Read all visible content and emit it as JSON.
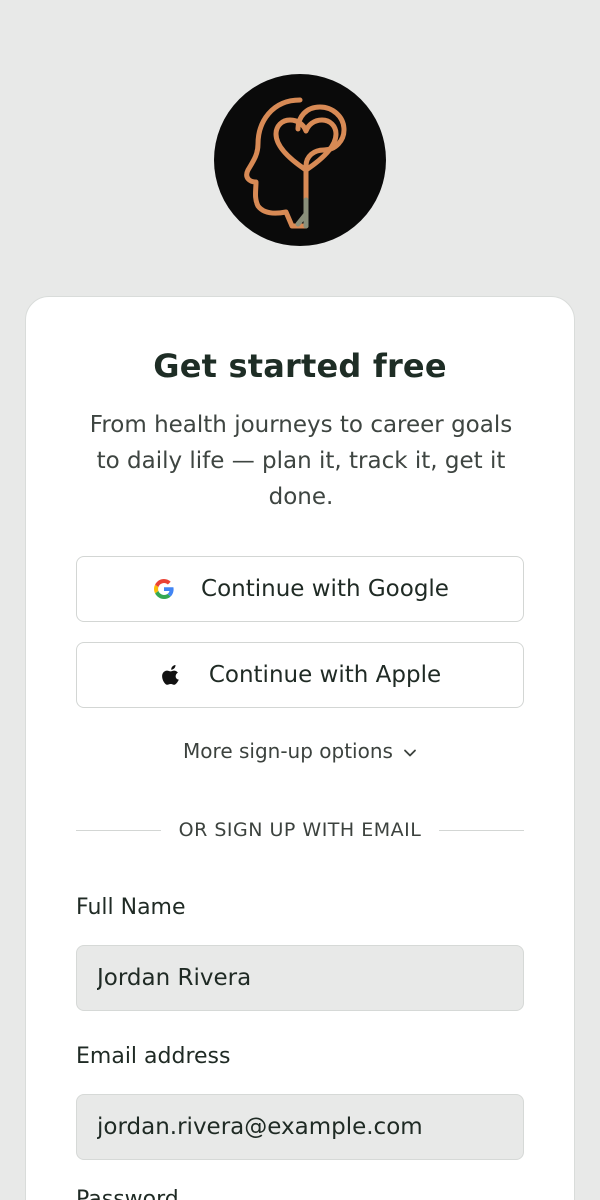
{
  "brand": {
    "logo_icon": "head-heart-logo-icon",
    "logo_colors": {
      "background": "#0a0a0a",
      "head_outline": "#d88a55",
      "stem": "#8a8f7a"
    }
  },
  "card": {
    "title": "Get started free",
    "subtitle": "From health journeys to career goals to daily life — plan it, track it, get it done.",
    "google_button_label": "Continue with Google",
    "apple_button_label": "Continue with Apple",
    "more_options_label": "More sign-up options",
    "divider_text": "OR SIGN UP WITH EMAIL"
  },
  "form": {
    "full_name": {
      "label": "Full Name",
      "value": "Jordan Rivera"
    },
    "email": {
      "label": "Email address",
      "value": "jordan.rivera@example.com"
    },
    "password": {
      "label": "Password"
    }
  },
  "icons": {
    "google": "google-icon",
    "apple": "apple-icon",
    "more_options": "chevron-down-icon"
  }
}
